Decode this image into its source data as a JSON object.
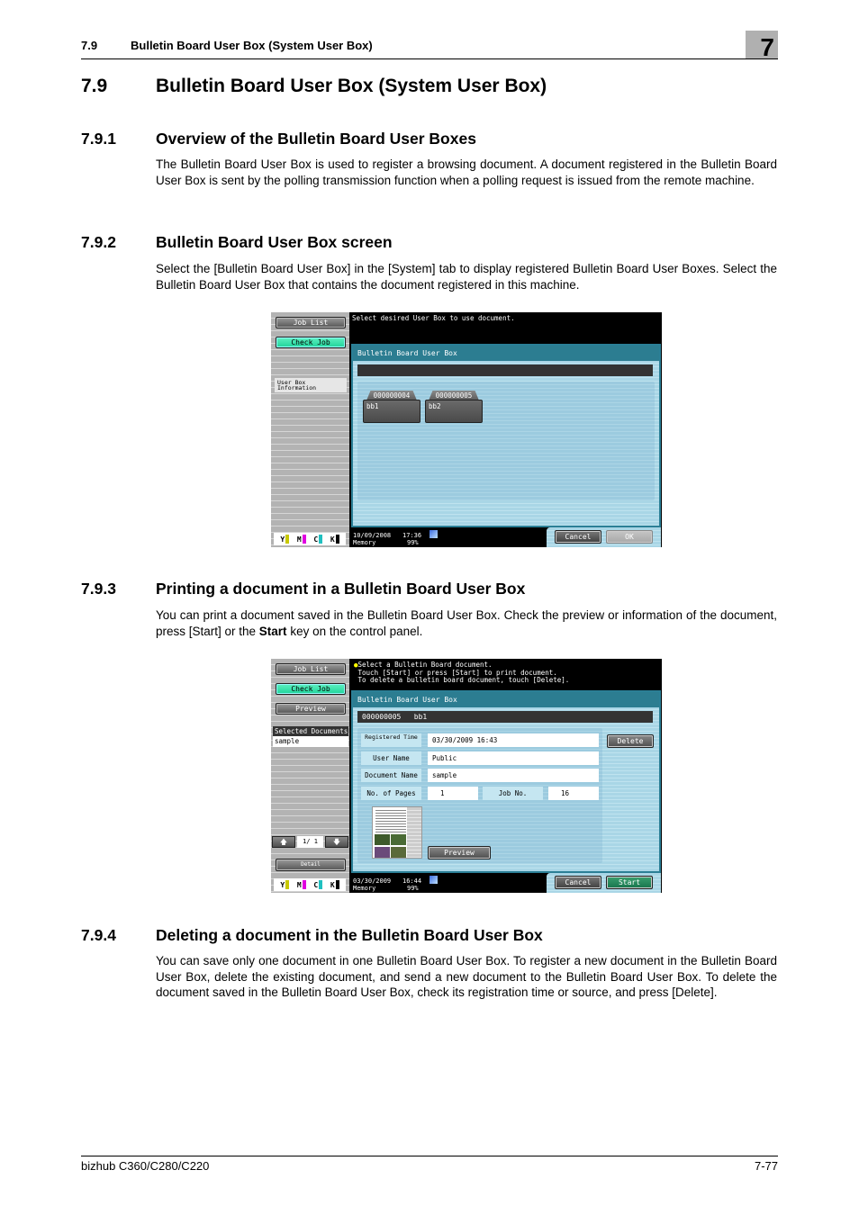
{
  "header": {
    "section_number": "7.9",
    "section_title": "Bulletin Board User Box (System User Box)",
    "chapter_number": "7"
  },
  "section": {
    "number": "7.9",
    "title": "Bulletin Board User Box (System User Box)"
  },
  "subsections": [
    {
      "number": "7.9.1",
      "title": "Overview of the Bulletin Board User Boxes",
      "body": "The Bulletin Board User Box is used to register a browsing document. A document registered in the Bulletin Board User Box is sent by the polling transmission function when a polling request is issued from the remote machine."
    },
    {
      "number": "7.9.2",
      "title": "Bulletin Board User Box screen",
      "body": "Select the [Bulletin Board User Box] in the [System] tab to display registered Bulletin Board User Boxes. Select the Bulletin Board User Box that contains the document registered in this machine."
    },
    {
      "number": "7.9.3",
      "title": "Printing a document in a Bulletin Board User Box",
      "body_before_bold": "You can print a document saved in the Bulletin Board User Box. Check the preview or information of the document, press [Start] or the ",
      "body_bold": "Start",
      "body_after_bold": " key on the control panel."
    },
    {
      "number": "7.9.4",
      "title": "Deleting a document in the Bulletin Board User Box",
      "body": "You can save only one document in one Bulletin Board User Box. To register a new document in the Bulletin Board User Box, delete the existing document, and send a new document to the Bulletin Board User Box. To delete the document saved in the Bulletin Board User Box, check its registration time or source, and press [Delete]."
    }
  ],
  "screen1": {
    "sidebar": {
      "job_list": "Job List",
      "check_job": "Check Job",
      "user_box_info": "User Box Information"
    },
    "message": "Select desired User Box to use document.",
    "panel_title": "Bulletin Board User Box",
    "boxes": [
      {
        "number": "000000004",
        "name": "bb1"
      },
      {
        "number": "000000005",
        "name": "bb2"
      }
    ],
    "status": {
      "date": "10/09/2008",
      "time": "17:36",
      "memory_label": "Memory",
      "memory_value": "99%"
    },
    "cancel": "Cancel",
    "ok": "OK",
    "toner": [
      "Y",
      "M",
      "C",
      "K"
    ]
  },
  "screen2": {
    "sidebar": {
      "job_list": "Job List",
      "check_job": "Check Job",
      "preview": "Preview",
      "selected_documents_header": "Selected Documents",
      "selected_documents": [
        "sample"
      ],
      "page_indicator": "1/ 1",
      "detail": "Detail"
    },
    "message": "Select a Bulletin Board document.\n Touch [Start] or press [Start] to print document.\n To delete a bulletin board document, touch [Delete].",
    "panel_title": "Bulletin Board User Box",
    "box_header": "000000005   bb1",
    "fields": {
      "registered_time_label": "Registered Time",
      "registered_time": "03/30/2009 16:43",
      "user_name_label": "User Name",
      "user_name": "Public",
      "document_name_label": "Document Name",
      "document_name": "sample",
      "pages_label": "No. of Pages",
      "pages": "1",
      "job_no_label": "Job No.",
      "job_no": "16"
    },
    "delete": "Delete",
    "preview": "Preview",
    "status": {
      "date": "03/30/2009",
      "time": "16:44",
      "memory_label": "Memory",
      "memory_value": "99%"
    },
    "cancel": "Cancel",
    "start": "Start",
    "toner": [
      "Y",
      "M",
      "C",
      "K"
    ]
  },
  "colors": {
    "toner_y": "#c8c800",
    "toner_m": "#e000e0",
    "toner_c": "#20c0c0",
    "toner_k": "#000000",
    "accent_green": "#2ad8a0",
    "panel_teal": "#2c7d91"
  },
  "footer": {
    "product": "bizhub C360/C280/C220",
    "page": "7-77"
  }
}
